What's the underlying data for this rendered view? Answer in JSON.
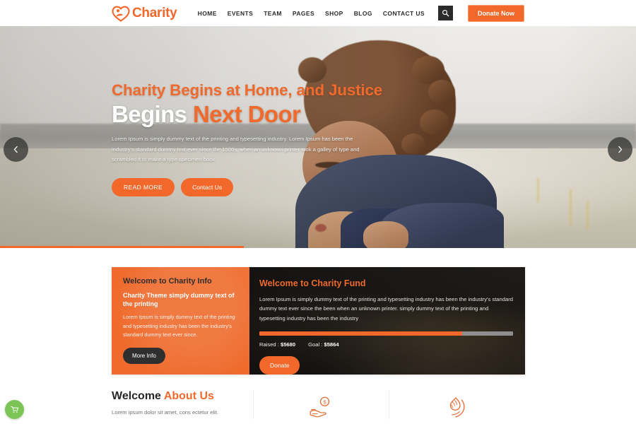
{
  "header": {
    "logo_text": "Charity",
    "logo_icon": "heart-hand-logo-icon",
    "nav": [
      {
        "label": "HOME"
      },
      {
        "label": "EVENTS"
      },
      {
        "label": "TEAM"
      },
      {
        "label": "PAGES"
      },
      {
        "label": "SHOP"
      },
      {
        "label": "BLOG"
      },
      {
        "label": "CONTACT US"
      }
    ],
    "search_icon": "search-icon",
    "donate_now_label": "Donate Now"
  },
  "hero": {
    "headline": "Charity Begins at Home, and Justice",
    "subhead_white": "Begins ",
    "subhead_orange": "Next Door",
    "paragraph": "Lorem Ipsum is simply dummy text of the printing and typesetting industry. Lorem Ipsum has been the industry's standard dummy text ever since the 1500s, when an unknown printer took a galley of type and scrambled it to make a type specimen book.",
    "btn_read_more": "READ MORE",
    "btn_contact": "Contact Us",
    "prev_icon": "chevron-left-icon",
    "next_icon": "chevron-right-icon"
  },
  "card_info": {
    "title": "Welcome to Charity Info",
    "subtitle": "Charity Theme simply dummy text of the printing",
    "text": "Lorem Ipsum is simply dummy text of the printing and typesetting industry has been the industry's standard dummy text ever since.",
    "button_label": "More Info"
  },
  "card_fund": {
    "title": "Welcome to Charity Fund",
    "text": "Lorem Ipsum is simply dummy text of the printing and typesetting industry has been the industry's standard dummy text ever since the been when an unknown printer. simply dummy text of the printing and typesetting industry has been the industry",
    "raised_label": "Raised : ",
    "raised_value": "$5680",
    "goal_label": "Goal : ",
    "goal_value": "$5864",
    "progress_percent": "80%",
    "button_label": "Donate"
  },
  "about": {
    "title_dark": "Welcome ",
    "title_orange": "About Us",
    "subtitle": "Lorem ipsum dolor sit amet, cons ectetur elit.",
    "features": [
      {
        "icon": "hand-coin-donation-icon"
      },
      {
        "icon": "hand-flame-care-icon"
      }
    ]
  },
  "floating": {
    "cart_icon": "shopping-cart-icon"
  },
  "colors": {
    "accent_orange": "#f2682a",
    "heading_orange": "#ef6a2c",
    "dark": "#2b2b2b",
    "cart_green": "#7cc455"
  }
}
